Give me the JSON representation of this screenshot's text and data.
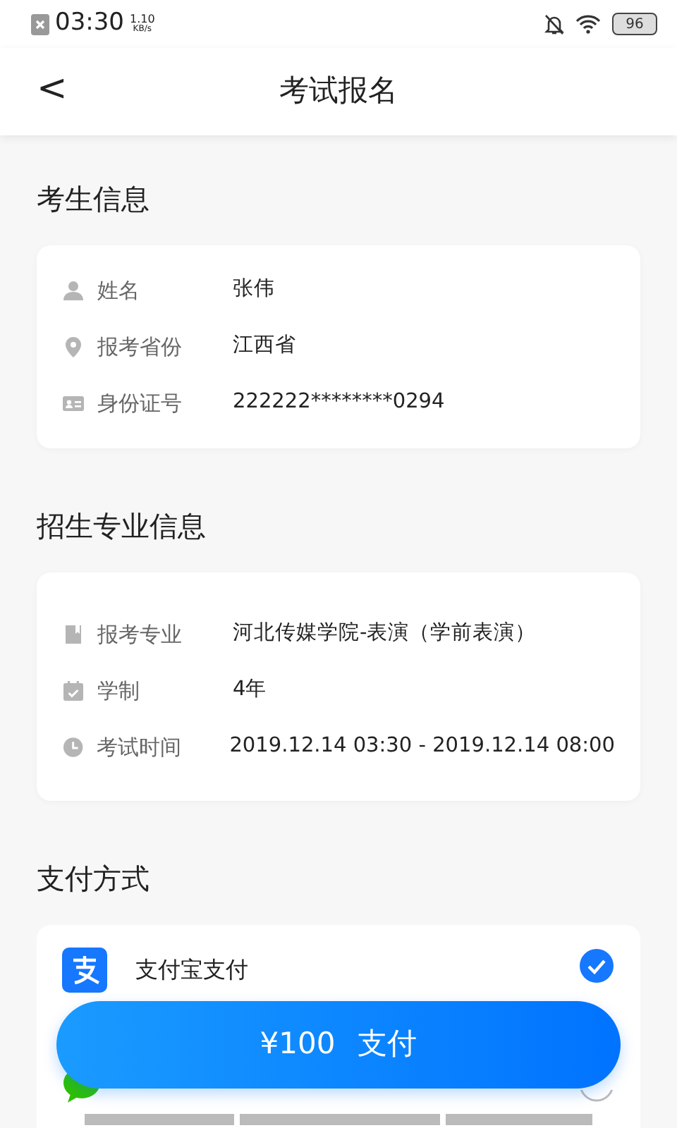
{
  "status_bar": {
    "time": "03:30",
    "net_speed": "1.10",
    "net_unit": "KB/s",
    "battery": "96"
  },
  "header": {
    "back": "<",
    "title": "考试报名"
  },
  "sections": [
    {
      "title": "考生信息",
      "rows": [
        {
          "kind": "person",
          "label": "姓名",
          "value": "张伟"
        },
        {
          "kind": "location",
          "label": "报考省份",
          "value": "江西省"
        },
        {
          "kind": "id-card",
          "label": "身份证号",
          "value": "222222********0294"
        }
      ]
    },
    {
      "title": "招生专业信息",
      "rows": [
        {
          "kind": "book",
          "label": "报考专业",
          "value": "河北传媒学院-表演（学前表演）"
        },
        {
          "kind": "calendar",
          "label": "学制",
          "value": "4年"
        },
        {
          "kind": "clock",
          "label": "考试时间",
          "value": "2019.12.14 03:30 - 2019.12.14 08:00"
        }
      ]
    }
  ],
  "payment": {
    "title": "支付方式",
    "options": [
      {
        "kind": "alipay",
        "label": "支付宝支付",
        "selected": true
      },
      {
        "kind": "wechat",
        "selected": false
      }
    ]
  },
  "pay_button": {
    "amount": "¥100",
    "label": "支付"
  }
}
